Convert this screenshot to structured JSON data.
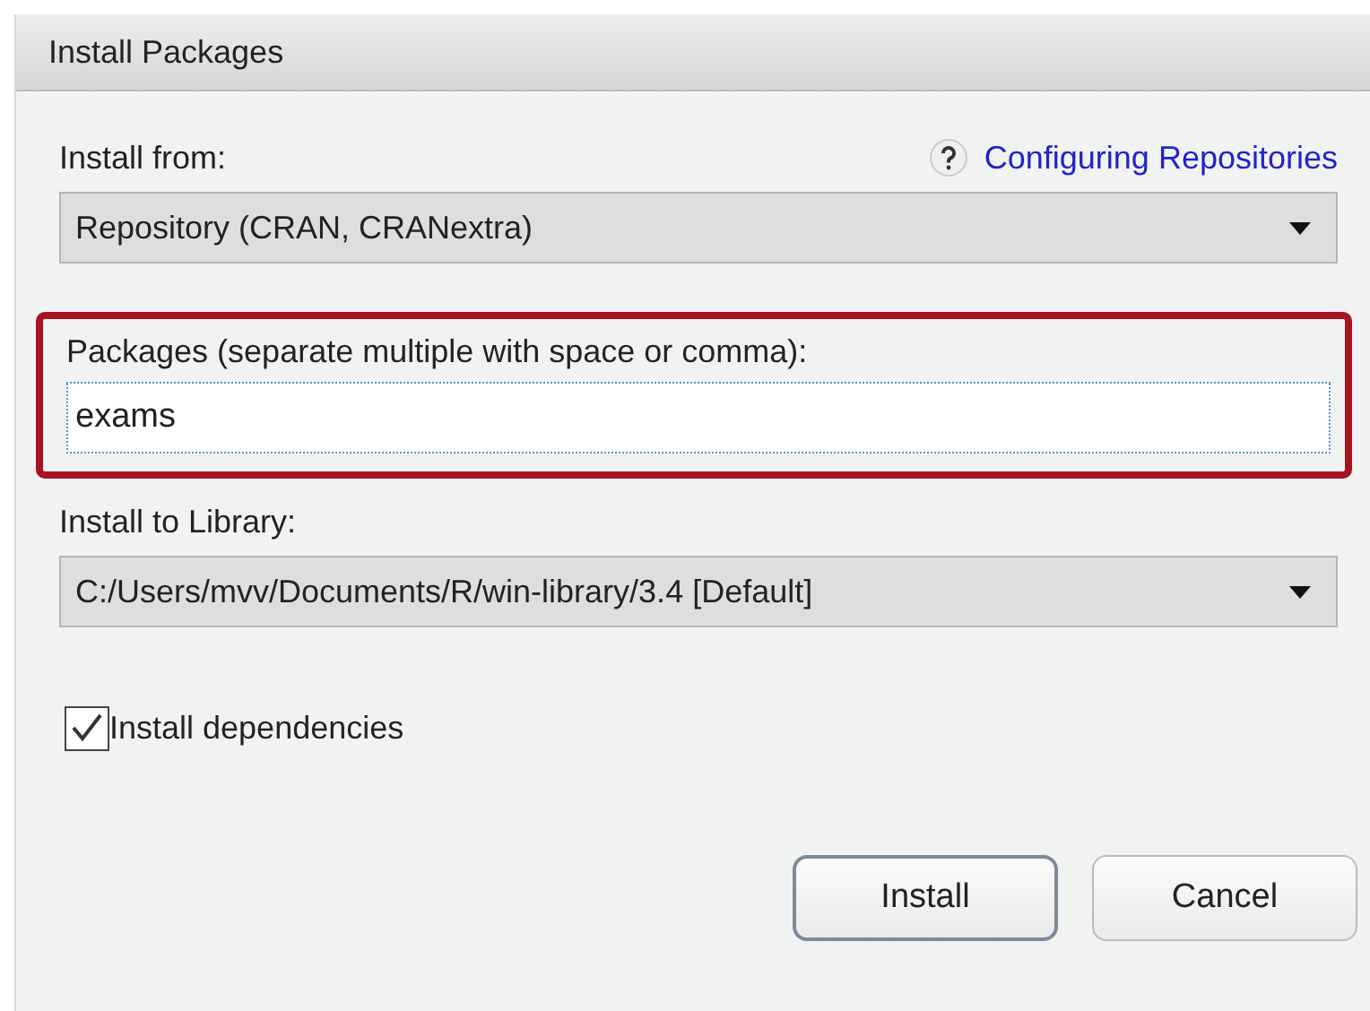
{
  "window": {
    "title": "Install Packages"
  },
  "install_from": {
    "label": "Install from:",
    "help_link": "Configuring Repositories",
    "value": "Repository (CRAN, CRANextra)"
  },
  "packages": {
    "label": "Packages (separate multiple with space or comma):",
    "value": "exams",
    "highlighted": true
  },
  "library": {
    "label": "Install to Library:",
    "value": "C:/Users/mvv/Documents/R/win-library/3.4 [Default]"
  },
  "dependencies": {
    "label": "Install dependencies",
    "checked": true
  },
  "buttons": [
    {
      "label": "Install",
      "default": true
    },
    {
      "label": "Cancel",
      "default": false
    }
  ]
}
